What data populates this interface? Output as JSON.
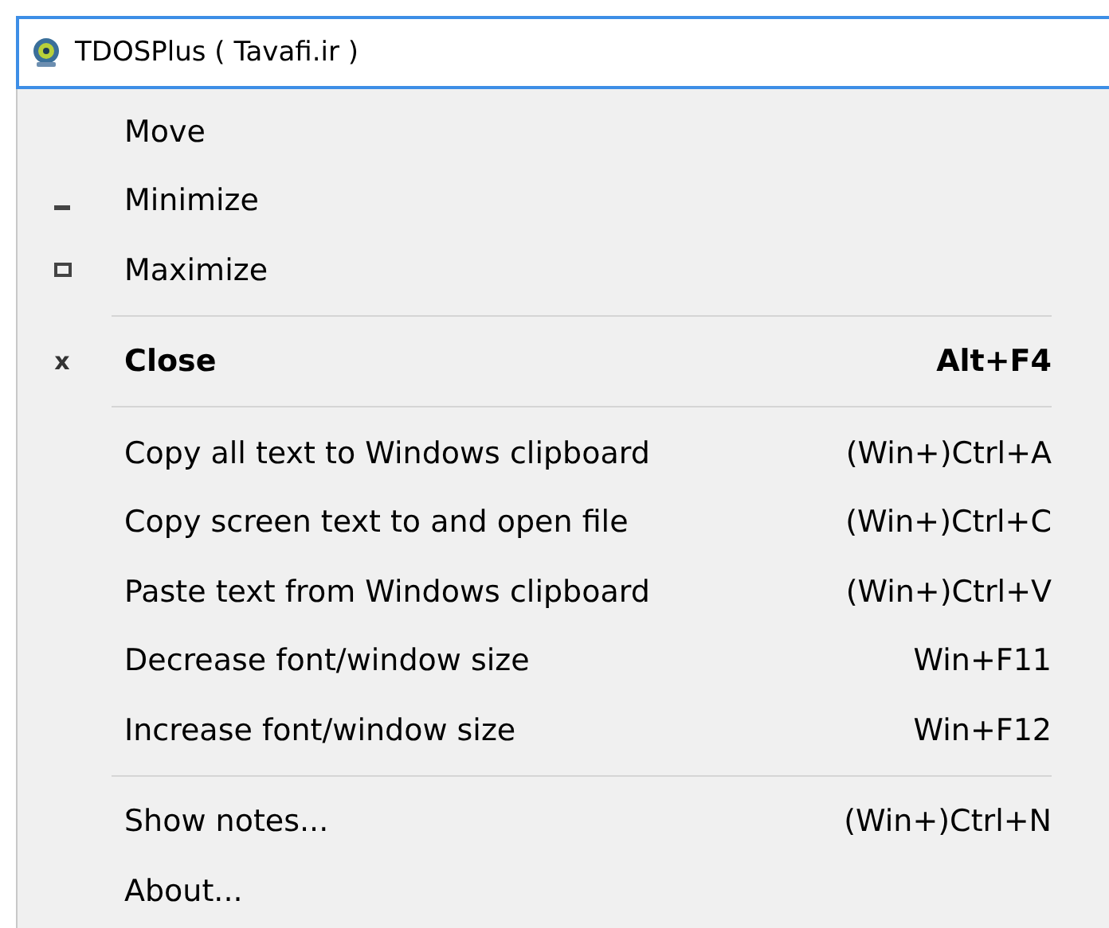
{
  "window": {
    "title": "TDOSPlus ( Tavafi.ir )"
  },
  "menu": [
    {
      "kind": "plain",
      "label": "Move"
    },
    {
      "kind": "minimize",
      "label": "Minimize"
    },
    {
      "kind": "maximize",
      "label": "Maximize"
    },
    {
      "kind": "separator"
    },
    {
      "kind": "close",
      "label": "Close",
      "mark": "x",
      "shortcut": "Alt+F4"
    },
    {
      "kind": "separator"
    },
    {
      "kind": "plain",
      "label": "Copy all text to Windows clipboard",
      "shortcut": "(Win+)Ctrl+A"
    },
    {
      "kind": "plain",
      "label": "Copy screen text to and open file",
      "shortcut": "(Win+)Ctrl+C"
    },
    {
      "kind": "plain",
      "label": "Paste text from Windows clipboard",
      "shortcut": "(Win+)Ctrl+V"
    },
    {
      "kind": "plain",
      "label": "Decrease font/window size",
      "shortcut": "Win+F11"
    },
    {
      "kind": "plain",
      "label": "Increase font/window size",
      "shortcut": "Win+F12"
    },
    {
      "kind": "separator"
    },
    {
      "kind": "plain",
      "label": "Show notes...",
      "shortcut": "(Win+)Ctrl+N"
    },
    {
      "kind": "plain",
      "label": "About..."
    }
  ]
}
